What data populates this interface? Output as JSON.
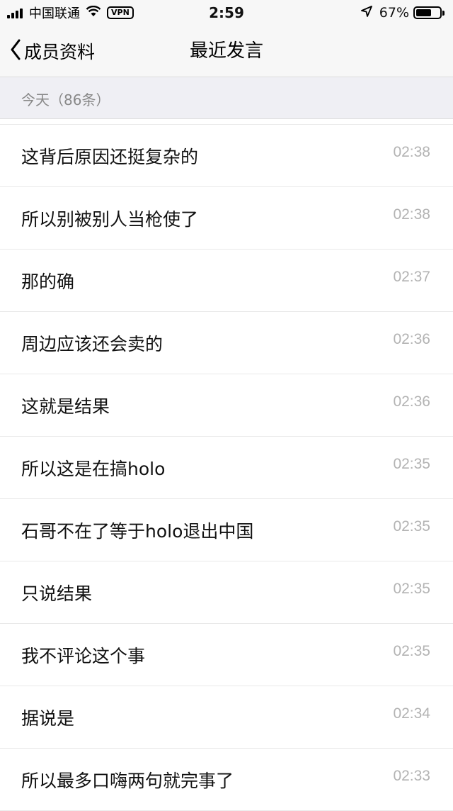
{
  "status_bar": {
    "carrier": "中国联通",
    "vpn": "VPN",
    "time": "2:59",
    "battery": "67%",
    "battery_level": 0.67
  },
  "nav": {
    "back_label": "成员资料",
    "title": "最近发言"
  },
  "section": {
    "label": "今天（86条）"
  },
  "messages": [
    {
      "text": "这背后原因还挺复杂的",
      "time": "02:38"
    },
    {
      "text": "所以别被别人当枪使了",
      "time": "02:38"
    },
    {
      "text": "那的确",
      "time": "02:37"
    },
    {
      "text": "周边应该还会卖的",
      "time": "02:36"
    },
    {
      "text": "这就是结果",
      "time": "02:36"
    },
    {
      "text": "所以这是在搞holo",
      "time": "02:35"
    },
    {
      "text": "石哥不在了等于holo退出中国",
      "time": "02:35"
    },
    {
      "text": "只说结果",
      "time": "02:35"
    },
    {
      "text": "我不评论这个事",
      "time": "02:35"
    },
    {
      "text": "据说是",
      "time": "02:34"
    },
    {
      "text": "所以最多口嗨两句就完事了",
      "time": "02:33"
    }
  ]
}
